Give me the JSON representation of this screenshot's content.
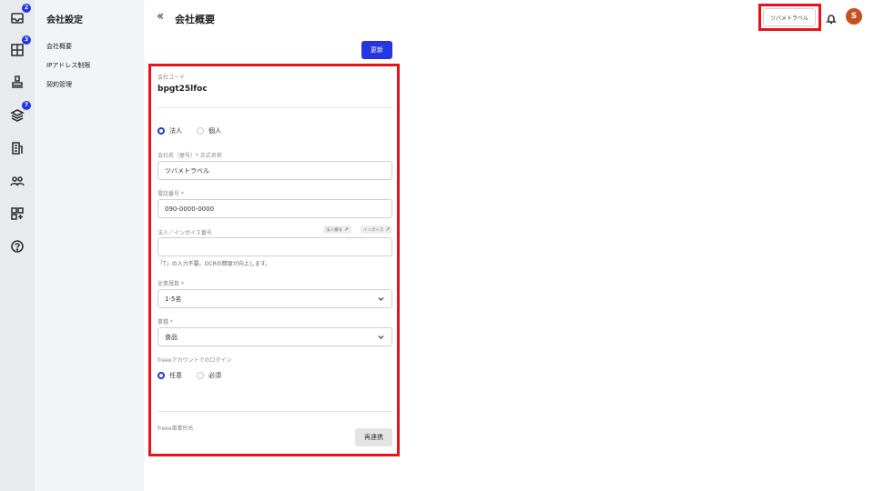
{
  "rail": {
    "items": [
      {
        "icon": "inbox-icon",
        "badge": "2"
      },
      {
        "icon": "grid-plus-icon",
        "badge": "3"
      },
      {
        "icon": "stamp-icon",
        "badge": ""
      },
      {
        "icon": "layers-icon",
        "badge": "7"
      },
      {
        "icon": "building-icon",
        "badge": ""
      },
      {
        "icon": "users-icon",
        "badge": ""
      },
      {
        "icon": "apps-add-icon",
        "badge": ""
      },
      {
        "icon": "help-icon",
        "badge": ""
      }
    ]
  },
  "subnav": {
    "title": "会社設定",
    "items": [
      "会社概要",
      "IPアドレス制限",
      "契約管理"
    ]
  },
  "header": {
    "back_icon": "double-chevron-left-icon",
    "title": "会社概要",
    "tenant_label": "ツバメトラベル",
    "avatar_initial": "S"
  },
  "actions": {
    "update_label": "更新"
  },
  "form": {
    "company_code_label": "会社コード",
    "company_code_value": "bpgt25lfoc",
    "entity_type": {
      "options": [
        "法人",
        "個人"
      ],
      "selected": "法人"
    },
    "company_name_label": "会社名（屋号）* 正式名称",
    "company_name_value": "ツバメトラベル",
    "phone_label": "電話番号 *",
    "phone_value": "090-0000-0000",
    "invoice_label": "法人／インボイス番号",
    "invoice_value": "",
    "invoice_link_1": "法人番号",
    "invoice_link_2": "インボイス",
    "invoice_hint": "「T」の入力不要。OCRの精度が向上します。",
    "employees_label": "従業員数 *",
    "employees_value": "1-5名",
    "industry_label": "業種 *",
    "industry_value": "食品",
    "freee_login_label": "freeeアカウントでのログイン",
    "freee_login": {
      "options": [
        "任意",
        "必須"
      ],
      "selected": "任意"
    },
    "freee_office_label": "freee事業所名",
    "relink_label": "再連携"
  },
  "colors": {
    "accent": "#2436e0",
    "highlight": "#e8121c",
    "avatar": "#c4501e"
  }
}
